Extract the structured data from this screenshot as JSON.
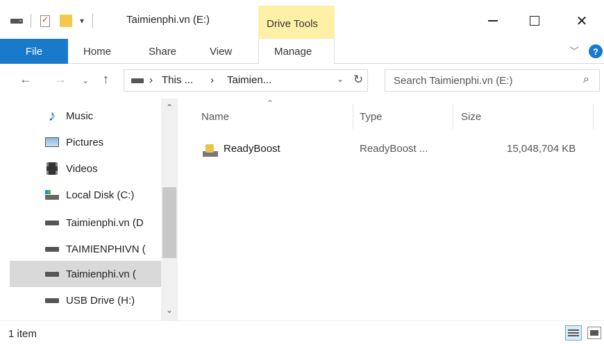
{
  "window": {
    "title": "Taimienphi.vn (E:)",
    "context_tab": "Drive Tools",
    "controls": {
      "minimize": "—",
      "maximize": "☐",
      "close": "✕"
    }
  },
  "ribbon": {
    "tabs": [
      {
        "label": "File"
      },
      {
        "label": "Home"
      },
      {
        "label": "Share"
      },
      {
        "label": "View"
      },
      {
        "label": "Manage"
      }
    ],
    "help": "?"
  },
  "addressbar": {
    "crumbs": [
      "This ...",
      "Taimien..."
    ],
    "separator": "›"
  },
  "search": {
    "placeholder": "Search Taimienphi.vn (E:)"
  },
  "navpane": {
    "items": [
      {
        "label": "Music",
        "icon": "music-icon"
      },
      {
        "label": "Pictures",
        "icon": "pictures-icon"
      },
      {
        "label": "Videos",
        "icon": "videos-icon"
      },
      {
        "label": "Local Disk (C:)",
        "icon": "local-disk-icon"
      },
      {
        "label": "Taimienphi.vn (D",
        "icon": "drive-icon"
      },
      {
        "label": "TAIMIENPHIVN (",
        "icon": "drive-icon"
      },
      {
        "label": "Taimienphi.vn (",
        "icon": "drive-icon",
        "selected": true
      },
      {
        "label": "USB Drive (H:)",
        "icon": "drive-icon"
      }
    ]
  },
  "columns": {
    "name": "Name",
    "type": "Type",
    "size": "Size"
  },
  "files": [
    {
      "name": "ReadyBoost",
      "type": "ReadyBoost ...",
      "size": "15,048,704 KB",
      "icon": "readyboost-icon"
    }
  ],
  "status": {
    "count": "1 item"
  }
}
